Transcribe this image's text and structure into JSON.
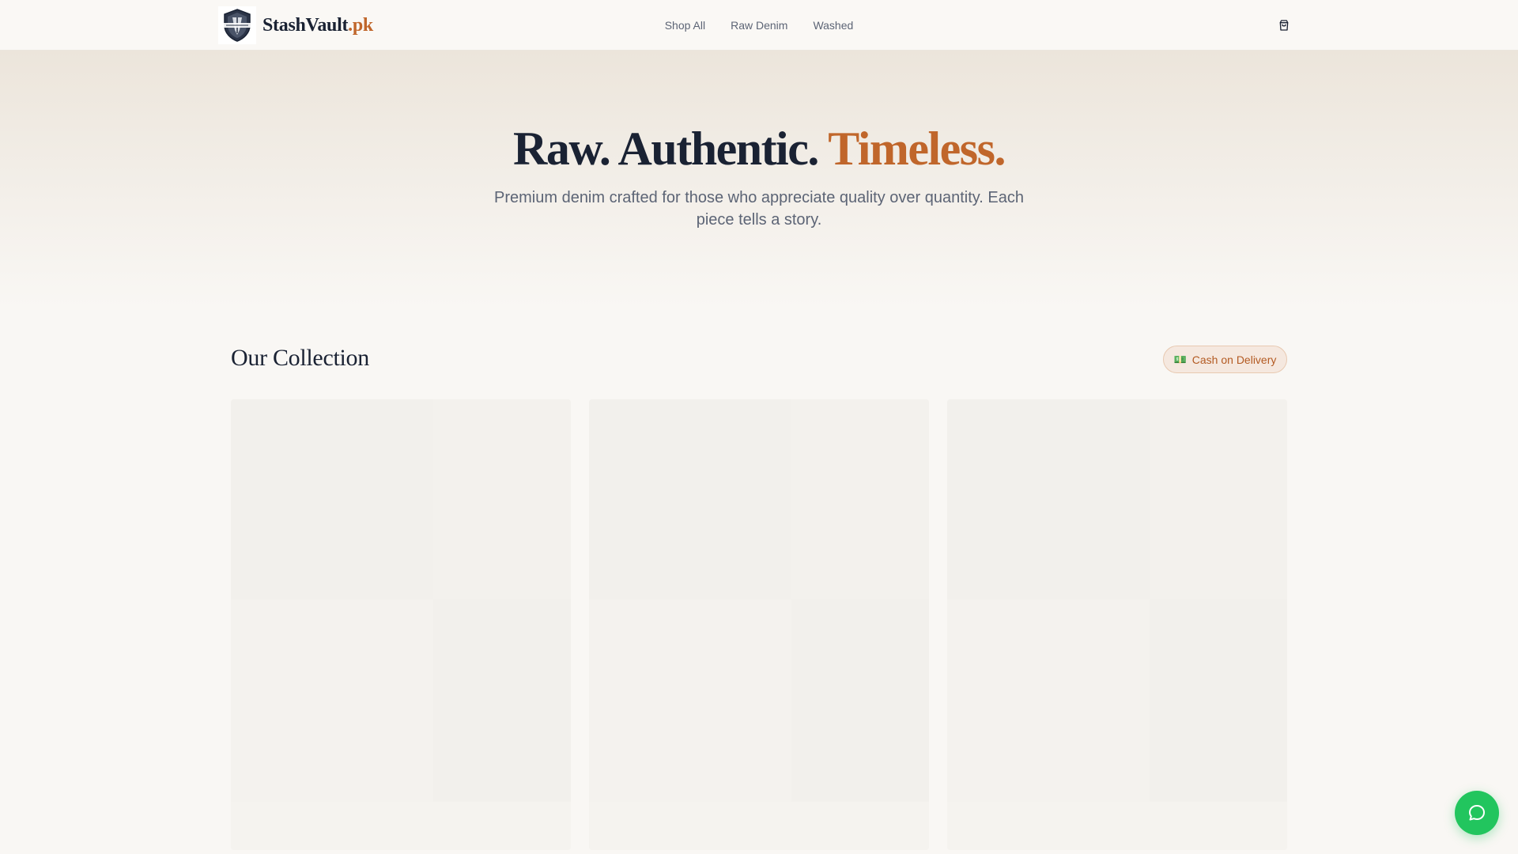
{
  "header": {
    "brand_name": "StashVault",
    "brand_suffix": ".pk",
    "nav_links": [
      "Shop All",
      "Raw Denim",
      "Washed"
    ],
    "cart_icon": "shopping-bag-icon"
  },
  "hero": {
    "title_part1": "Raw. Authentic.",
    "title_accent": "Timeless.",
    "subtitle": "Premium denim crafted for those who appreciate quality over quantity. Each piece tells a story."
  },
  "collection": {
    "title": "Our Collection",
    "badge_icon": "💵",
    "badge_label": "Cash on Delivery",
    "products": [
      {
        "state": "loading"
      },
      {
        "state": "loading"
      },
      {
        "state": "loading"
      }
    ]
  },
  "chat": {
    "icon": "chat-bubble-icon"
  },
  "colors": {
    "accent": "#c0662b",
    "text_dark": "#1a2233",
    "text_muted": "#5c6475",
    "chat_green": "#22c55e",
    "page_background": "#f9f7f4"
  }
}
